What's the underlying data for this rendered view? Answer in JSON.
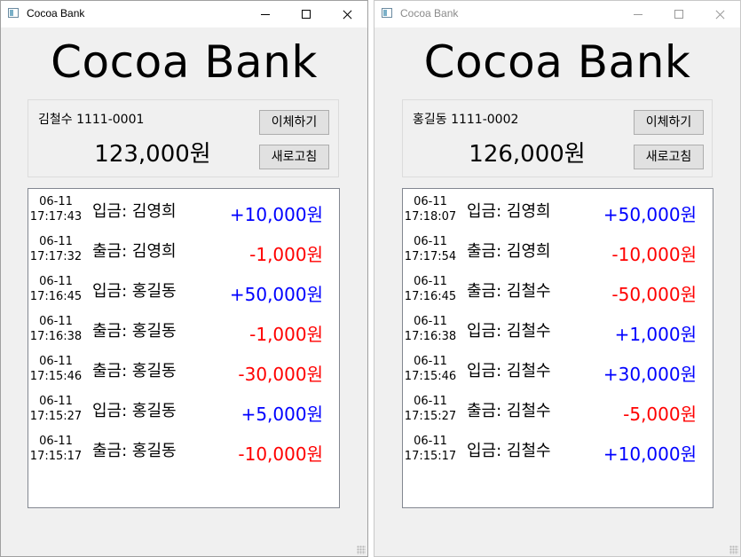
{
  "windows": [
    {
      "window_title": "Cocoa Bank",
      "app_title": "Cocoa Bank",
      "account_info": "김철수 1111-0001",
      "balance": "123,000원",
      "transfer_label": "이체하기",
      "refresh_label": "새로고침",
      "transactions": [
        {
          "date": "06-11",
          "time": "17:17:43",
          "desc": "입금: 김영희",
          "amount": "+10,000원",
          "type": "deposit"
        },
        {
          "date": "06-11",
          "time": "17:17:32",
          "desc": "출금: 김영희",
          "amount": "-1,000원",
          "type": "withdrawal"
        },
        {
          "date": "06-11",
          "time": "17:16:45",
          "desc": "입금: 홍길동",
          "amount": "+50,000원",
          "type": "deposit"
        },
        {
          "date": "06-11",
          "time": "17:16:38",
          "desc": "출금: 홍길동",
          "amount": "-1,000원",
          "type": "withdrawal"
        },
        {
          "date": "06-11",
          "time": "17:15:46",
          "desc": "출금: 홍길동",
          "amount": "-30,000원",
          "type": "withdrawal"
        },
        {
          "date": "06-11",
          "time": "17:15:27",
          "desc": "입금: 홍길동",
          "amount": "+5,000원",
          "type": "deposit"
        },
        {
          "date": "06-11",
          "time": "17:15:17",
          "desc": "출금: 홍길동",
          "amount": "-10,000원",
          "type": "withdrawal"
        }
      ]
    },
    {
      "window_title": "Cocoa Bank",
      "app_title": "Cocoa Bank",
      "account_info": "홍길동 1111-0002",
      "balance": "126,000원",
      "transfer_label": "이체하기",
      "refresh_label": "새로고침",
      "transactions": [
        {
          "date": "06-11",
          "time": "17:18:07",
          "desc": "입금: 김영희",
          "amount": "+50,000원",
          "type": "deposit"
        },
        {
          "date": "06-11",
          "time": "17:17:54",
          "desc": "출금: 김영희",
          "amount": "-10,000원",
          "type": "withdrawal"
        },
        {
          "date": "06-11",
          "time": "17:16:45",
          "desc": "출금: 김철수",
          "amount": "-50,000원",
          "type": "withdrawal"
        },
        {
          "date": "06-11",
          "time": "17:16:38",
          "desc": "입금: 김철수",
          "amount": "+1,000원",
          "type": "deposit"
        },
        {
          "date": "06-11",
          "time": "17:15:46",
          "desc": "입금: 김철수",
          "amount": "+30,000원",
          "type": "deposit"
        },
        {
          "date": "06-11",
          "time": "17:15:27",
          "desc": "출금: 김철수",
          "amount": "-5,000원",
          "type": "withdrawal"
        },
        {
          "date": "06-11",
          "time": "17:15:17",
          "desc": "입금: 김철수",
          "amount": "+10,000원",
          "type": "deposit"
        }
      ]
    }
  ],
  "colors": {
    "deposit": "#0000ff",
    "withdrawal": "#ff0000",
    "window_bg": "#f0f0f0"
  },
  "icons": {
    "app": "app-window-icon",
    "minimize": "minimize-icon",
    "maximize": "maximize-icon",
    "close": "close-icon"
  }
}
